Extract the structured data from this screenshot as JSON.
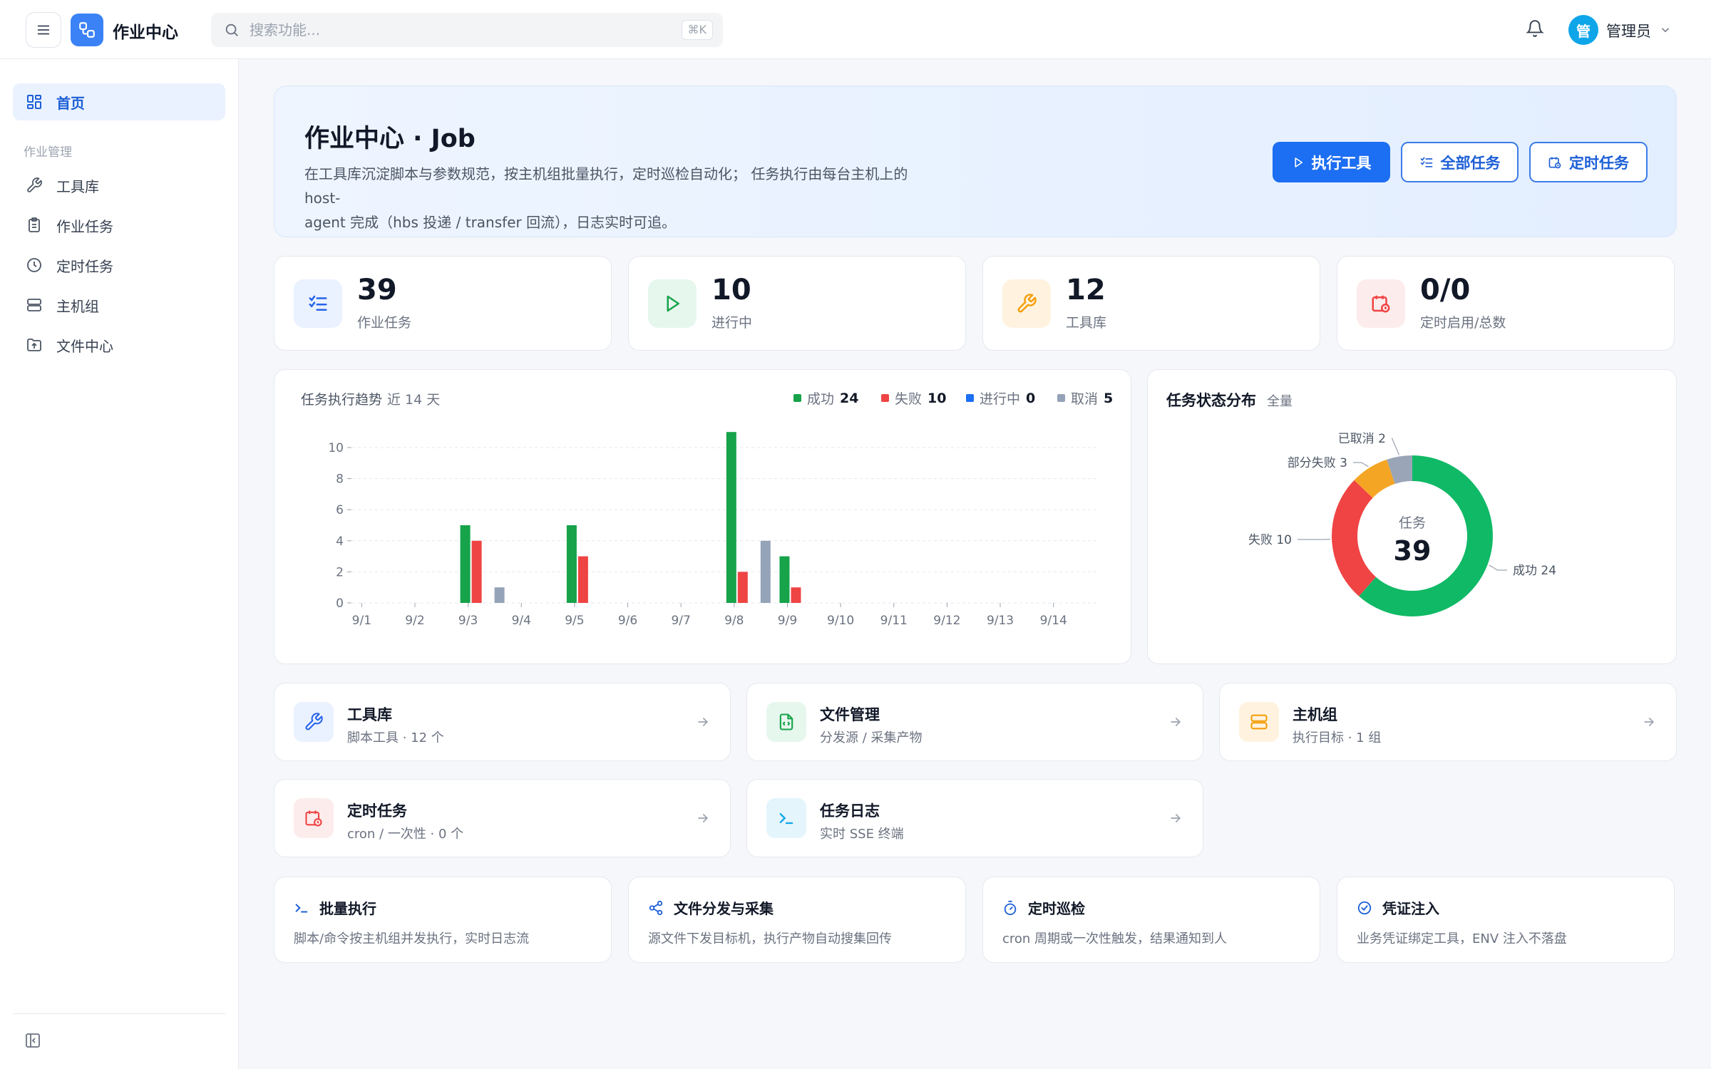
{
  "header": {
    "app_title": "作业中心",
    "search_placeholder": "搜索功能...",
    "search_shortcut": "⌘K",
    "user_initial": "管",
    "user_name": "管理员"
  },
  "sidebar": {
    "home_label": "首页",
    "group_label": "作业管理",
    "items": [
      {
        "label": "工具库",
        "icon": "wrench-icon"
      },
      {
        "label": "作业任务",
        "icon": "clipboard-icon"
      },
      {
        "label": "定时任务",
        "icon": "clock-icon"
      },
      {
        "label": "主机组",
        "icon": "server-icon"
      },
      {
        "label": "文件中心",
        "icon": "folder-upload-icon"
      }
    ]
  },
  "hero": {
    "title": "作业中心 · Job",
    "desc_line1": "在工具库沉淀脚本与参数规范，按主机组批量执行，定时巡检自动化； 任务执行由每台主机上的 host-",
    "desc_line2": "agent 完成（hbs 投递 / transfer 回流），日志实时可追。",
    "btn_run": "执行工具",
    "btn_all": "全部任务",
    "btn_cron": "定时任务"
  },
  "stats": [
    {
      "value": "39",
      "label": "作业任务",
      "color": "#2563eb"
    },
    {
      "value": "10",
      "label": "进行中",
      "color": "#16a34a"
    },
    {
      "value": "12",
      "label": "工具库",
      "color": "#f59e0b"
    },
    {
      "value": "0/0",
      "label": "定时启用/总数",
      "color": "#ef4444"
    }
  ],
  "trend": {
    "title": "任务执行趋势",
    "subtitle": "近 14 天",
    "legend": [
      {
        "name": "成功",
        "total": "24",
        "color": "#16a34a"
      },
      {
        "name": "失败",
        "total": "10",
        "color": "#ef4444"
      },
      {
        "name": "进行中",
        "total": "0",
        "color": "#1c6ef2"
      },
      {
        "name": "取消",
        "total": "5",
        "color": "#94a3b8"
      }
    ]
  },
  "chart_data": [
    {
      "type": "bar",
      "title": "任务执行趋势",
      "subtitle": "近 14 天",
      "categories": [
        "9/1",
        "9/2",
        "9/3",
        "9/4",
        "9/5",
        "9/6",
        "9/7",
        "9/8",
        "9/9",
        "9/10",
        "9/11",
        "9/12",
        "9/13",
        "9/14"
      ],
      "series": [
        {
          "name": "成功",
          "color": "#16a34a",
          "values": [
            0,
            0,
            5,
            0,
            5,
            0,
            0,
            11,
            3,
            0,
            0,
            0,
            0,
            0
          ]
        },
        {
          "name": "失败",
          "color": "#ef4444",
          "values": [
            0,
            0,
            4,
            0,
            3,
            0,
            0,
            2,
            1,
            0,
            0,
            0,
            0,
            0
          ]
        },
        {
          "name": "进行中",
          "color": "#1c6ef2",
          "values": [
            0,
            0,
            0,
            0,
            0,
            0,
            0,
            0,
            0,
            0,
            0,
            0,
            0,
            0
          ]
        },
        {
          "name": "取消",
          "color": "#94a3b8",
          "values": [
            0,
            0,
            1,
            0,
            0,
            0,
            0,
            4,
            0,
            0,
            0,
            0,
            0,
            0
          ]
        }
      ],
      "yticks": [
        0,
        2,
        4,
        6,
        8,
        10
      ],
      "ylim": [
        0,
        11
      ]
    },
    {
      "type": "pie",
      "title": "任务状态分布",
      "subtitle": "全量",
      "center_label": "任务",
      "center_value": "39",
      "slices": [
        {
          "name": "成功",
          "value": 24,
          "label": "成功 24",
          "color": "#10b966"
        },
        {
          "name": "失败",
          "value": 10,
          "label": "失败 10",
          "color": "#f04444"
        },
        {
          "name": "部分失败",
          "value": 3,
          "label": "部分失败 3",
          "color": "#f5a524"
        },
        {
          "name": "已取消",
          "value": 2,
          "label": "已取消 2",
          "color": "#9aa6b8"
        }
      ]
    }
  ],
  "entries": [
    {
      "title": "工具库",
      "sub": "脚本工具 · 12 个",
      "icon": "wrench-icon",
      "color": "#2563eb"
    },
    {
      "title": "文件管理",
      "sub": "分发源 / 采集产物",
      "icon": "file-code-icon",
      "color": "#16a34a"
    },
    {
      "title": "主机组",
      "sub": "执行目标 · 1 组",
      "icon": "server-icon",
      "color": "#f59e0b"
    },
    {
      "title": "定时任务",
      "sub": "cron / 一次性 · 0 个",
      "icon": "calendar-clock-icon",
      "color": "#ef4444"
    },
    {
      "title": "任务日志",
      "sub": "实时 SSE 终端",
      "icon": "terminal-icon",
      "color": "#0ea5e9"
    }
  ],
  "features": [
    {
      "title": "批量执行",
      "desc": "脚本/命令按主机组并发执行，实时日志流",
      "icon": "terminal-icon"
    },
    {
      "title": "文件分发与采集",
      "desc": "源文件下发目标机，执行产物自动搜集回传",
      "icon": "share-icon"
    },
    {
      "title": "定时巡检",
      "desc": "cron 周期或一次性触发，结果通知到人",
      "icon": "timer-icon"
    },
    {
      "title": "凭证注入",
      "desc": "业务凭证绑定工具，ENV 注入不落盘",
      "icon": "check-circle-icon"
    }
  ]
}
